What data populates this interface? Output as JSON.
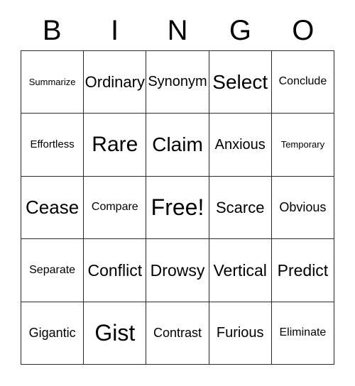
{
  "card": {
    "title": "BINGO",
    "background_color": "#ffffff",
    "text_color": "#000000",
    "border_color": "#2b2b2b"
  },
  "header": {
    "letters": [
      {
        "label": "B"
      },
      {
        "label": "I"
      },
      {
        "label": "N"
      },
      {
        "label": "G"
      },
      {
        "label": "O"
      }
    ]
  },
  "grid": {
    "columns": 5,
    "rows": 5,
    "free_space": "Free!",
    "cells": [
      [
        {
          "label": "Summarize",
          "size": "fs-xs"
        },
        {
          "label": "Ordinary",
          "size": "fs-l"
        },
        {
          "label": "Synonym",
          "size": "fs-ml"
        },
        {
          "label": "Select",
          "size": "fs-3xl"
        },
        {
          "label": "Conclude",
          "size": "fs-sm"
        }
      ],
      [
        {
          "label": "Effortless",
          "size": "fs-s"
        },
        {
          "label": "Rare",
          "size": "fs-4xl"
        },
        {
          "label": "Claim",
          "size": "fs-3xl"
        },
        {
          "label": "Anxious",
          "size": "fs-ml"
        },
        {
          "label": "Temporary",
          "size": "fs-xs"
        }
      ],
      [
        {
          "label": "Cease",
          "size": "fs-2xl"
        },
        {
          "label": "Compare",
          "size": "fs-sm"
        },
        {
          "label": "Free!",
          "size": "fs-5xl"
        },
        {
          "label": "Scarce",
          "size": "fs-l"
        },
        {
          "label": "Obvious",
          "size": "fs-m"
        }
      ],
      [
        {
          "label": "Separate",
          "size": "fs-sm"
        },
        {
          "label": "Conflict",
          "size": "fs-xl"
        },
        {
          "label": "Drowsy",
          "size": "fs-xl"
        },
        {
          "label": "Vertical",
          "size": "fs-xl"
        },
        {
          "label": "Predict",
          "size": "fs-xl"
        }
      ],
      [
        {
          "label": "Gigantic",
          "size": "fs-m"
        },
        {
          "label": "Gist",
          "size": "fs-5xl"
        },
        {
          "label": "Contrast",
          "size": "fs-m"
        },
        {
          "label": "Furious",
          "size": "fs-ml"
        },
        {
          "label": "Eliminate",
          "size": "fs-sm"
        }
      ]
    ]
  }
}
